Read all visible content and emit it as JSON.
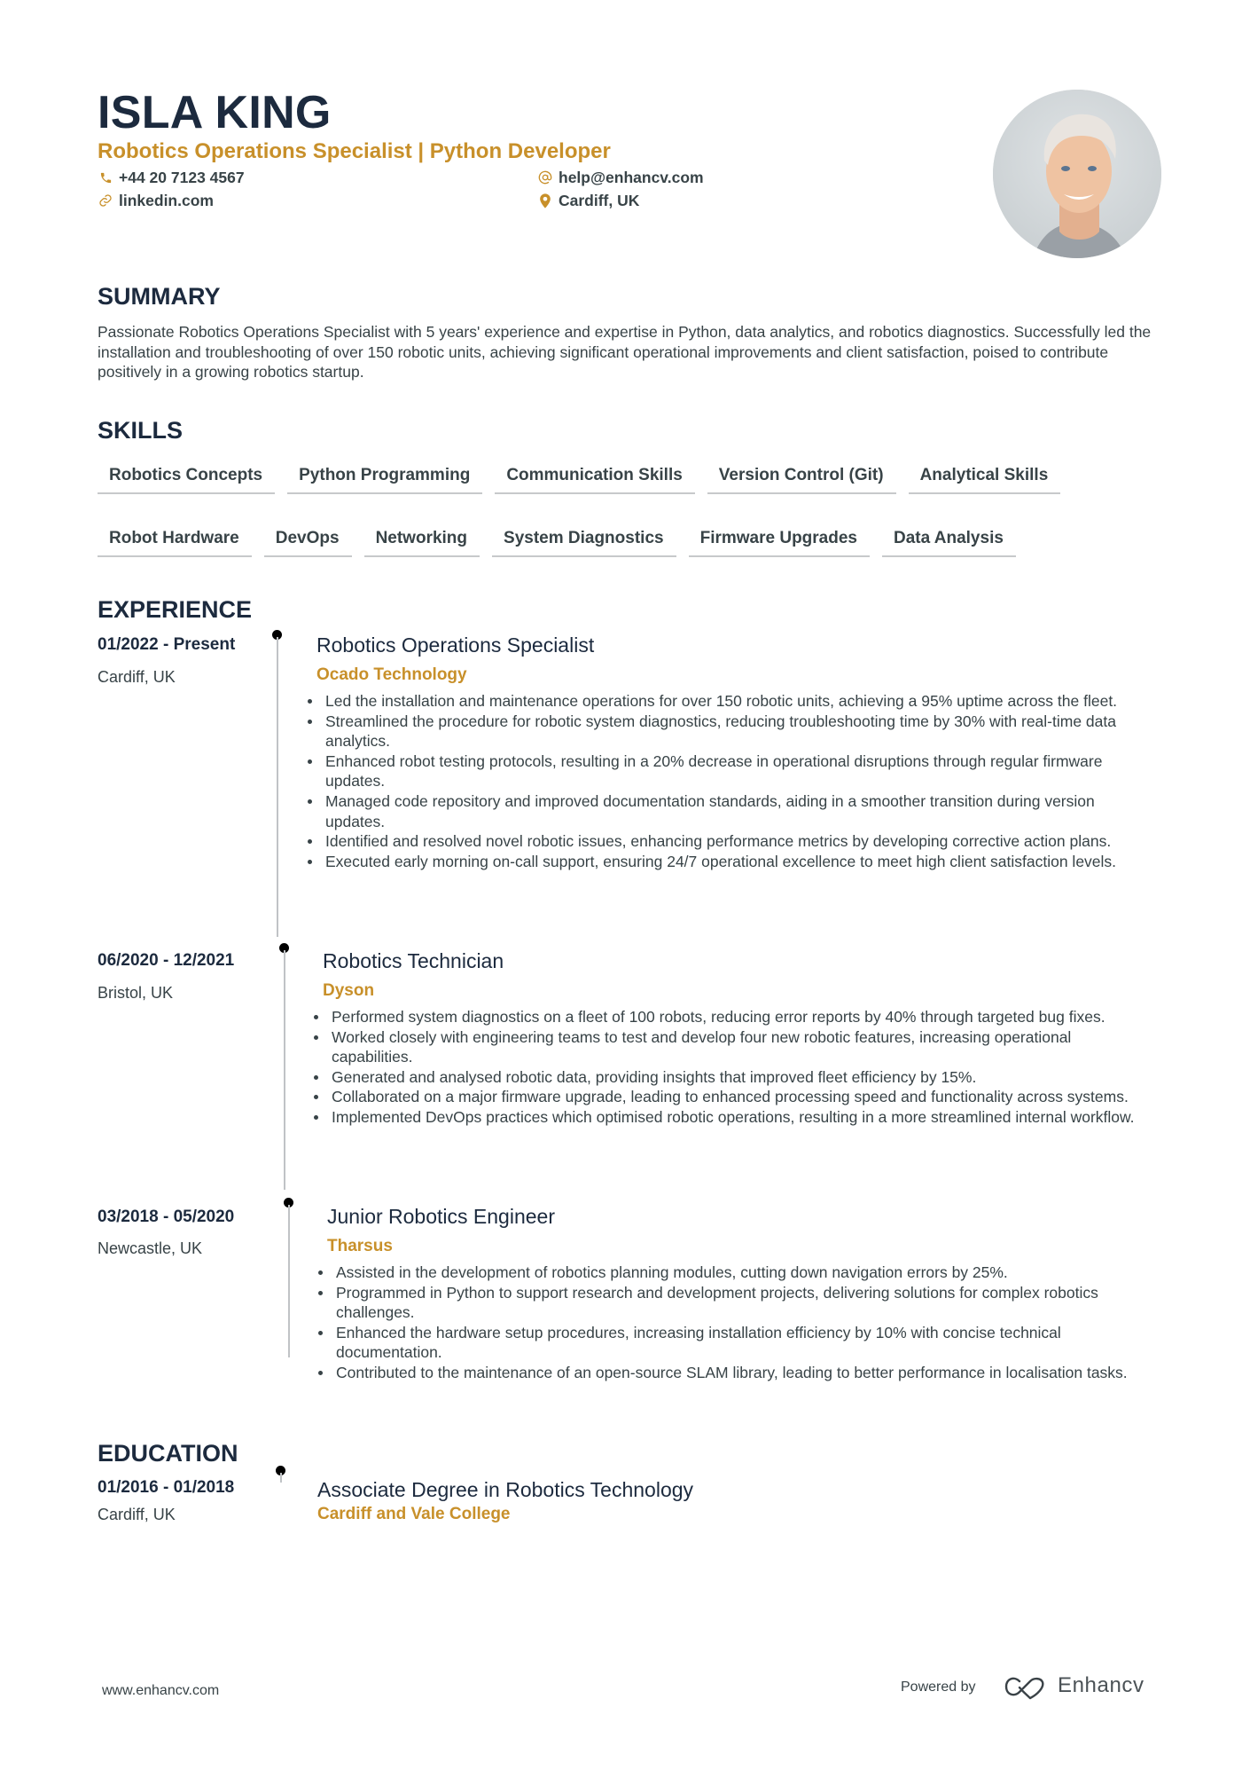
{
  "header": {
    "name": "ISLA KING",
    "title": "Robotics Operations Specialist | Python Developer",
    "contacts": [
      {
        "icon": "phone-icon",
        "text": "+44 20 7123 4567"
      },
      {
        "icon": "at-icon",
        "text": "help@enhancv.com"
      },
      {
        "icon": "link-icon",
        "text": "linkedin.com"
      },
      {
        "icon": "location-pin-icon",
        "text": "Cardiff, UK"
      }
    ],
    "photo_alt": "Profile photo"
  },
  "summary": {
    "heading": "SUMMARY",
    "text": "Passionate Robotics Operations Specialist with 5 years' experience and expertise in Python, data analytics, and robotics diagnostics. Successfully led the installation and troubleshooting of over 150 robotic units, achieving significant operational improvements and client satisfaction, poised to contribute positively in a growing robotics startup."
  },
  "skills": {
    "heading": "SKILLS",
    "items": [
      "Robotics Concepts",
      "Python Programming",
      "Communication Skills",
      "Version Control (Git)",
      "Analytical Skills",
      "Robot Hardware",
      "DevOps",
      "Networking",
      "System Diagnostics",
      "Firmware Upgrades",
      "Data Analysis"
    ]
  },
  "experience": {
    "heading": "EXPERIENCE",
    "jobs": [
      {
        "dates": "01/2022 - Present",
        "location": "Cardiff, UK",
        "title": "Robotics Operations Specialist",
        "company": "Ocado Technology",
        "bullets": [
          "Led the installation and maintenance operations for over 150 robotic units, achieving a 95% uptime across the fleet.",
          "Streamlined the procedure for robotic system diagnostics, reducing troubleshooting time by 30% with real-time data analytics.",
          "Enhanced robot testing protocols, resulting in a 20% decrease in operational disruptions through regular firmware updates.",
          "Managed code repository and improved documentation standards, aiding in a smoother transition during version updates.",
          "Identified and resolved novel robotic issues, enhancing performance metrics by developing corrective action plans.",
          "Executed early morning on-call support, ensuring 24/7 operational excellence to meet high client satisfaction levels."
        ]
      },
      {
        "dates": "06/2020 - 12/2021",
        "location": "Bristol, UK",
        "title": "Robotics Technician",
        "company": "Dyson",
        "bullets": [
          "Performed system diagnostics on a fleet of 100 robots, reducing error reports by 40% through targeted bug fixes.",
          "Worked closely with engineering teams to test and develop four new robotic features, increasing operational capabilities.",
          "Generated and analysed robotic data, providing insights that improved fleet efficiency by 15%.",
          "Collaborated on a major firmware upgrade, leading to enhanced processing speed and functionality across systems.",
          "Implemented DevOps practices which optimised robotic operations, resulting in a more streamlined internal workflow."
        ]
      },
      {
        "dates": "03/2018 - 05/2020",
        "location": "Newcastle, UK",
        "title": "Junior Robotics Engineer",
        "company": "Tharsus",
        "bullets": [
          "Assisted in the development of robotics planning modules, cutting down navigation errors by 25%.",
          "Programmed in Python to support research and development projects, delivering solutions for complex robotics challenges.",
          "Enhanced the hardware setup procedures, increasing installation efficiency by 10% with concise technical documentation.",
          "Contributed to the maintenance of an open-source SLAM library, leading to better performance in localisation tasks."
        ]
      }
    ]
  },
  "education": {
    "heading": "EDUCATION",
    "entries": [
      {
        "dates": "01/2016 - 01/2018",
        "location": "Cardiff, UK",
        "degree": "Associate Degree in Robotics Technology",
        "school": "Cardiff and Vale College"
      }
    ]
  },
  "footer": {
    "url": "www.enhancv.com",
    "powered_by": "Powered by",
    "brand": "Enhancv"
  },
  "colors": {
    "accent": "#c8902a",
    "heading": "#1c2a3e",
    "text": "#384347"
  }
}
